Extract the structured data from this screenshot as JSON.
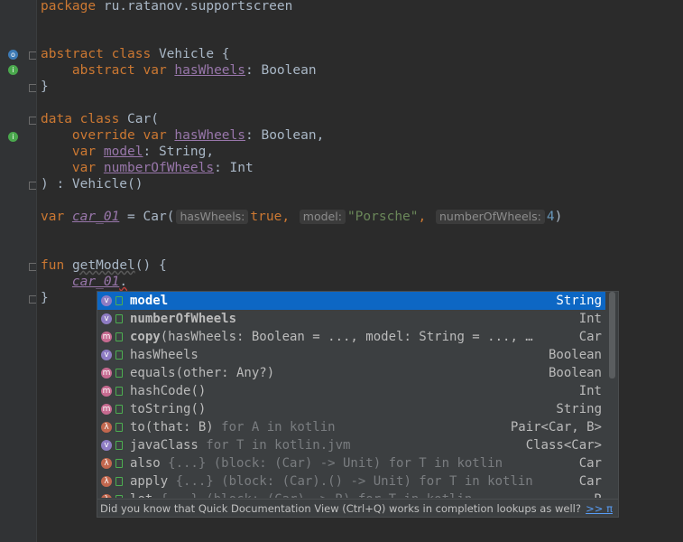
{
  "editor": {
    "package_line": {
      "kw": "package",
      "name": "ru.ratanov.supportscreen"
    },
    "vehicle": {
      "kw1": "abstract class",
      "name": "Vehicle {",
      "kw2": "abstract var",
      "prop": "hasWheels",
      "type": ": Boolean",
      "close": "}"
    },
    "car": {
      "kw1": "data class",
      "name": "Car(",
      "kw_override": "override var",
      "prop1": "hasWheels",
      "type1": ": Boolean,",
      "kw_var2": "var",
      "prop2": "model",
      "type2": ": String,",
      "kw_var3": "var",
      "prop3": "numberOfWheels",
      "type3": ": Int",
      "close": ") : Vehicle()"
    },
    "instance": {
      "kw": "var",
      "name": "car_01",
      "eq": " = Car(",
      "hint1": "hasWheels:",
      "val1": "true",
      "comma1": ",",
      "hint2": "model:",
      "val2": "\"Porsche\"",
      "comma2": ",",
      "hint3": "numberOfWheels:",
      "val3": "4",
      "close": ")"
    },
    "fun": {
      "kw": "fun",
      "name": "getModel",
      "rest": "() {",
      "call": "car_01",
      "dot": ".",
      "close": "}"
    }
  },
  "completion": {
    "items": [
      {
        "icon": "v",
        "name": "model",
        "tail": "",
        "type": "String",
        "bold": true
      },
      {
        "icon": "v",
        "name": "numberOfWheels",
        "tail": "",
        "type": "Int",
        "bold": true
      },
      {
        "icon": "m",
        "name": "copy",
        "tail": "(hasWheels: Boolean = ..., model: String = ..., …",
        "type": "Car",
        "bold": true
      },
      {
        "icon": "v",
        "name": "hasWheels",
        "tail": "",
        "type": "Boolean",
        "bold": false
      },
      {
        "icon": "m",
        "name": "equals",
        "tail": "(other: Any?)",
        "type": "Boolean",
        "bold": false
      },
      {
        "icon": "m",
        "name": "hashCode",
        "tail": "()",
        "type": "Int",
        "bold": false
      },
      {
        "icon": "m",
        "name": "toString",
        "tail": "()",
        "type": "String",
        "bold": false
      },
      {
        "icon": "λ",
        "name": "to",
        "tail": "(that: B) for A in kotlin",
        "type": "Pair<Car, B>",
        "bold": false
      },
      {
        "icon": "v",
        "name": "javaClass",
        "tail": " for T in kotlin.jvm",
        "type": "Class<Car>",
        "bold": false
      },
      {
        "icon": "λ",
        "name": "also",
        "tail": " {...} (block: (Car) -> Unit) for T in kotlin",
        "type": "Car",
        "bold": false
      },
      {
        "icon": "λ",
        "name": "apply",
        "tail": " {...} (block: (Car).() -> Unit) for T in kotlin",
        "type": "Car",
        "bold": false
      },
      {
        "icon": "λ",
        "name": "let",
        "tail": " {...} (block: (Car) -> R) for T in kotlin",
        "type": "R",
        "bold": false
      }
    ],
    "selected_index": 0,
    "footer": "Did you know that Quick Documentation View (Ctrl+Q) works in completion lookups as well?",
    "footer_link": ">> π"
  },
  "colors": {
    "background": "#2b2b2b",
    "keyword": "#cc7832",
    "property": "#9876aa",
    "string": "#6a8759",
    "number": "#6897bb",
    "selection": "#0d67c4",
    "icon_var": "#8e7cc3",
    "icon_method": "#c66a90",
    "icon_lambda": "#c2674e"
  }
}
